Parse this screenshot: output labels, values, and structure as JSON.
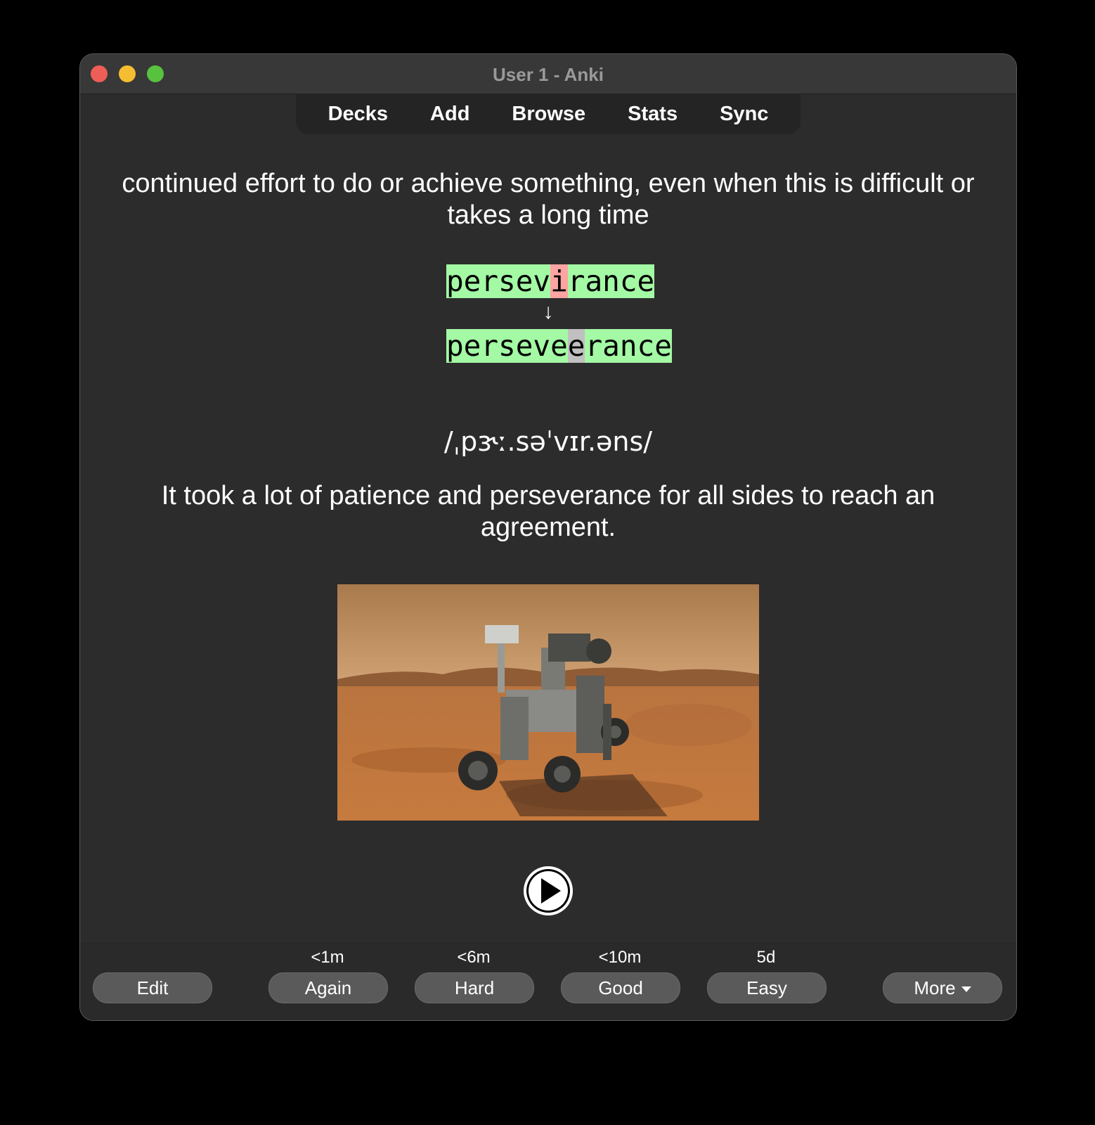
{
  "window": {
    "title": "User 1 - Anki"
  },
  "toolbar": {
    "items": [
      "Decks",
      "Add",
      "Browse",
      "Stats",
      "Sync"
    ]
  },
  "card": {
    "definition": "continued effort to do or achieve something, even when this is difficult or takes a long time",
    "typed_answer": {
      "pre": "persev",
      "wrong": "i",
      "post": "rance"
    },
    "arrow": "↓",
    "correct_answer": {
      "pre": "perseve",
      "missing": "e",
      "post": "rance"
    },
    "ipa": "/ˌpɝː.səˈvɪr.əns/",
    "example": "It took a lot of patience and perseverance for all sides to reach an agreement."
  },
  "answer_buttons": {
    "edit": "Edit",
    "again": {
      "label": "Again",
      "interval": "<1m"
    },
    "hard": {
      "label": "Hard",
      "interval": "<6m"
    },
    "good": {
      "label": "Good",
      "interval": "<10m"
    },
    "easy": {
      "label": "Easy",
      "interval": "5d"
    },
    "more": "More"
  },
  "colors": {
    "match": "#a4f9a4",
    "wrong": "#ffa3a3",
    "missed": "#c0c0c0"
  }
}
